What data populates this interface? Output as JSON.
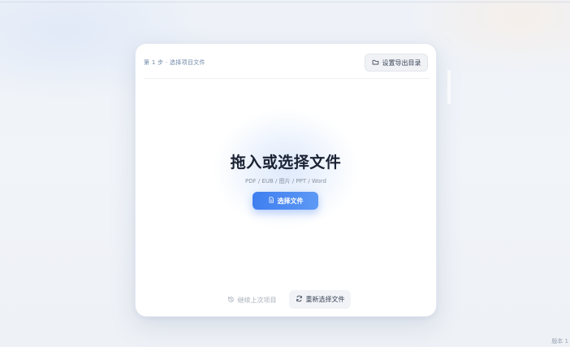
{
  "header": {
    "step_label": "第 1 步 · 选择项目文件",
    "export_button_label": "设置导出目录",
    "export_button_icon": "folder-icon"
  },
  "drop_zone": {
    "title": "拖入或选择文件",
    "formats": "PDF / EUB / 图片 / PPT / Word",
    "choose_button_label": "选择文件",
    "choose_button_icon": "file-icon"
  },
  "footer": {
    "continue_label": "继续上次项目",
    "continue_icon": "history-icon",
    "reselect_label": "重新选择文件",
    "reselect_icon": "refresh-icon"
  },
  "corner_text": "版本 1",
  "colors": {
    "accent": "#3f7ef0",
    "accent_light": "#5d99f5",
    "title": "#1a2233",
    "step_label": "#6e88a8",
    "muted": "#a9b0bc"
  }
}
